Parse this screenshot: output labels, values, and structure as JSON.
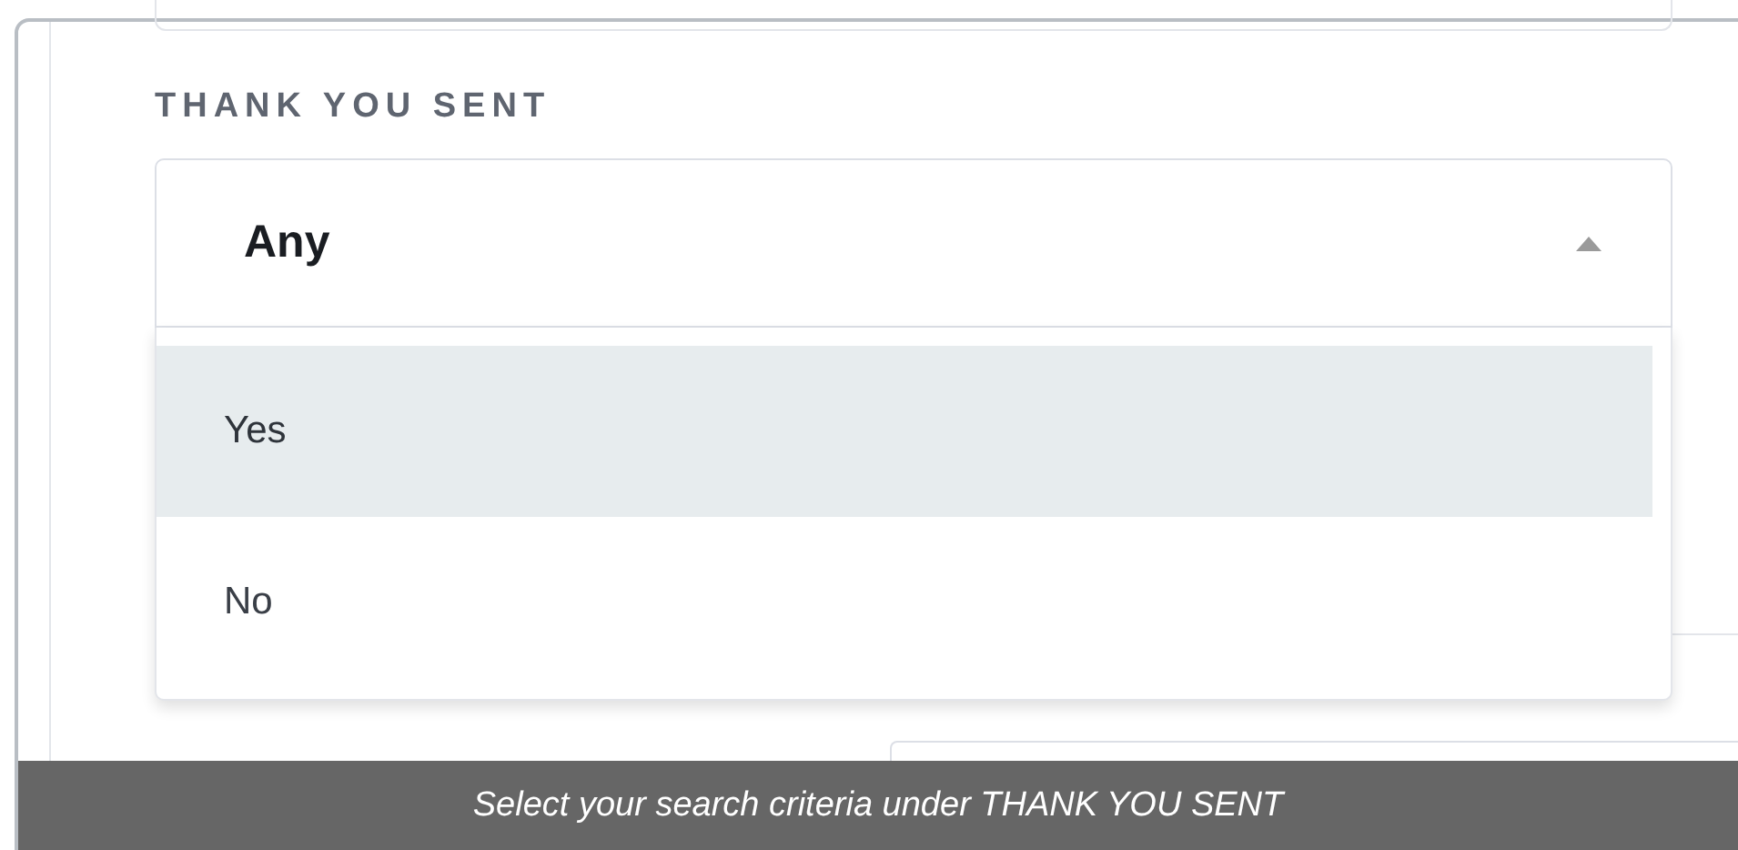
{
  "filter": {
    "label": "THANK YOU SENT",
    "value": "Any",
    "expanded": true,
    "options": [
      {
        "label": "Yes",
        "selected": true
      },
      {
        "label": "No",
        "selected": false
      }
    ]
  },
  "caption": "Select your search criteria under THANK YOU SENT"
}
